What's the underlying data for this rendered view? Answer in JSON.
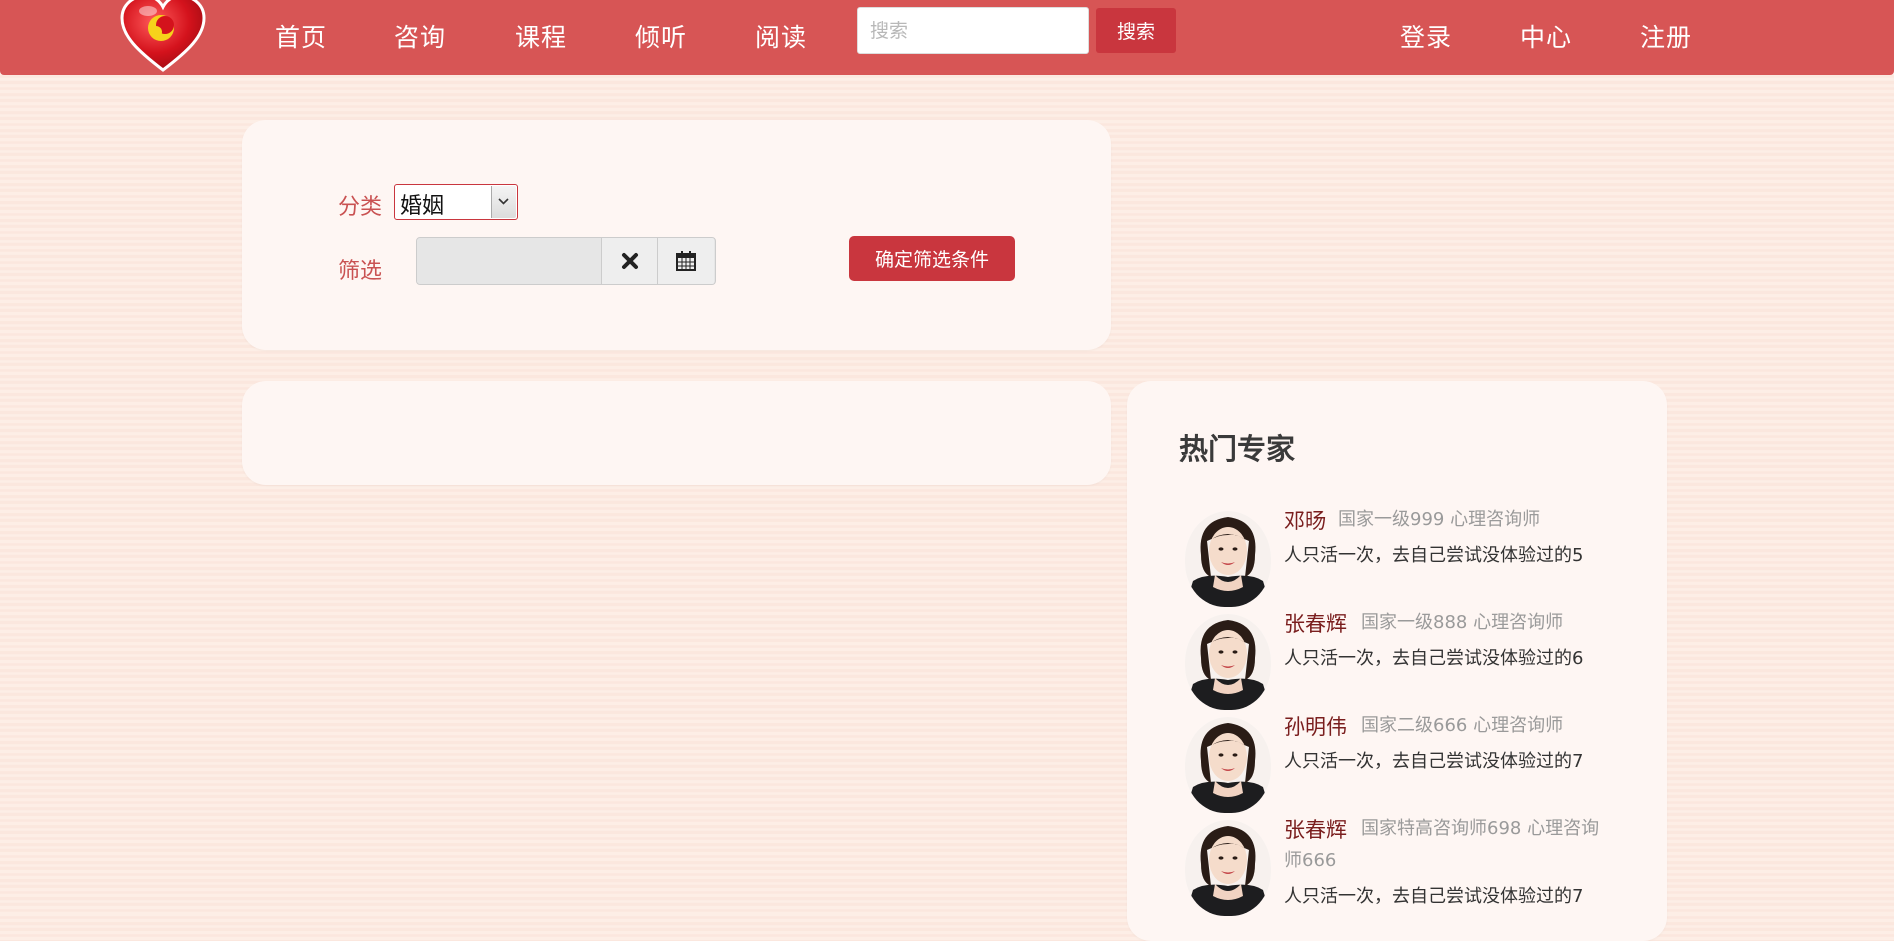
{
  "nav": {
    "items": [
      "首页",
      "咨询",
      "课程",
      "倾听",
      "阅读"
    ],
    "search_placeholder": "搜索",
    "search_button": "搜索",
    "user_links": [
      "登录",
      "中心",
      "注册"
    ]
  },
  "filter": {
    "category_label": "分类",
    "category_value": "婚姻",
    "filter_label": "筛选",
    "date_value": "",
    "confirm_button": "确定筛选条件"
  },
  "experts": {
    "title": "热门专家",
    "items": [
      {
        "name": "邓旸",
        "title": "国家一级999  心理咨询师",
        "quote": "人只活一次，去自己尝试没体验过的5"
      },
      {
        "name": "张春辉",
        "title": "国家一级888  心理咨询师",
        "quote": "人只活一次，去自己尝试没体验过的6"
      },
      {
        "name": "孙明伟",
        "title": "国家二级666  心理咨询师",
        "quote": "人只活一次，去自己尝试没体验过的7"
      },
      {
        "name": "张春辉",
        "title": "国家特高咨询师698  心理咨询师666",
        "quote": "人只活一次，去自己尝试没体验过的7"
      }
    ]
  },
  "colors": {
    "nav_bg": "#d75555",
    "accent": "#c9363e",
    "page_bg": "#fdeee6",
    "panel_bg": "#fef6f3"
  },
  "icons": [
    "heart-logo-icon",
    "close-icon",
    "calendar-icon",
    "chevron-down-icon"
  ]
}
